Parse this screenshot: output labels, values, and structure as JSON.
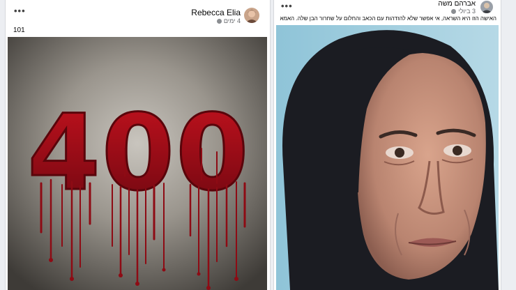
{
  "left_post": {
    "author": "Rebecca Elia",
    "time": "4 ימים",
    "text": "101",
    "image_text": "400",
    "icons": {
      "more": "more-options-icon",
      "privacy": "globe-icon"
    }
  },
  "right_post": {
    "author": "אברהם משה",
    "time": "3 ביולי",
    "text": "האישה הזו היא השראה, אי אפשר שלא להזדהות עם הכאב והחלום על שחרור הבן שלה. האמא מספרת על המאבק למען כל החטופים ברחבי הארץ",
    "icons": {
      "more": "more-options-icon",
      "privacy": "globe-icon"
    }
  },
  "colors": {
    "blood": "#8e0b14",
    "card": "#ffffff",
    "page": "#eceef2"
  }
}
